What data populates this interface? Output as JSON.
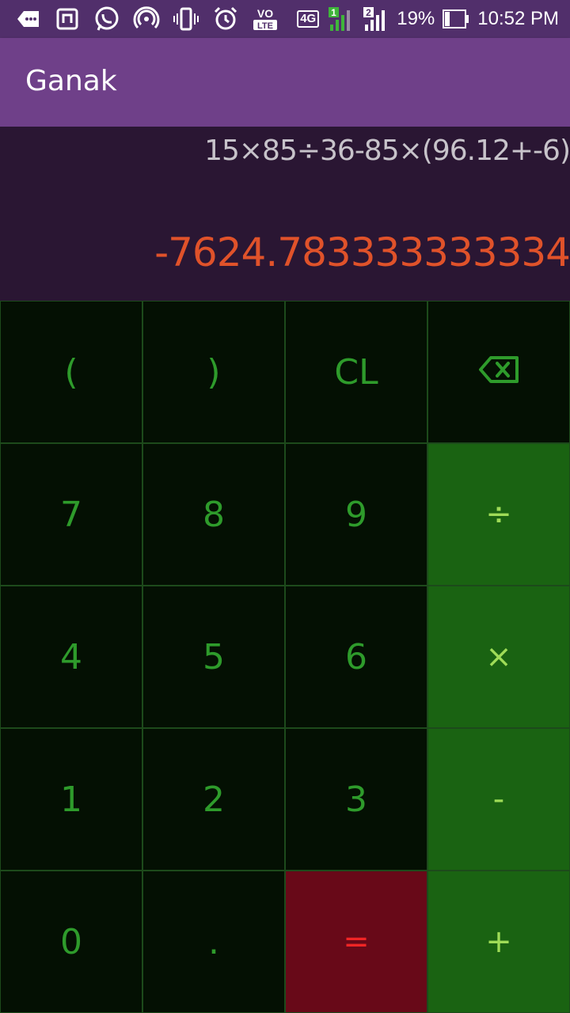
{
  "status_bar": {
    "battery_percent": "19%",
    "time": "10:52 PM",
    "network_badge": "4G",
    "sim1_label": "1",
    "sim2_label": "2",
    "volte_label": "VoLTE",
    "icons": [
      "more-notifications-icon",
      "nfc-tag-icon",
      "whatsapp-icon",
      "hotspot-icon",
      "vibrate-icon",
      "alarm-icon",
      "volte-icon",
      "network-4g-icon",
      "signal-sim1-icon",
      "signal-sim2-icon",
      "battery-icon"
    ]
  },
  "app_bar": {
    "title": "Ganak"
  },
  "display": {
    "expression": "15×85÷36-85×(96.12+-6)",
    "result": "-7624.783333333334"
  },
  "keypad": {
    "open_paren": "(",
    "close_paren": ")",
    "clear": "CL",
    "backspace_icon": "backspace-icon",
    "seven": "7",
    "eight": "8",
    "nine": "9",
    "divide": "÷",
    "four": "4",
    "five": "5",
    "six": "6",
    "multiply": "×",
    "one": "1",
    "two": "2",
    "three": "3",
    "minus": "-",
    "zero": "0",
    "dot": ".",
    "equals": "=",
    "plus": "+"
  },
  "colors": {
    "status_bar": "#512f6b",
    "app_bar": "#6f4089",
    "display_bg": "#2a1633",
    "expression_text": "#c7c3ca",
    "result_text": "#e0522a",
    "key_bg": "#041003",
    "key_text": "#2e9b2b",
    "operator_bg": "#1a6312",
    "operator_text": "#9fdc57",
    "equals_bg": "#680918",
    "equals_text": "#f02525"
  }
}
